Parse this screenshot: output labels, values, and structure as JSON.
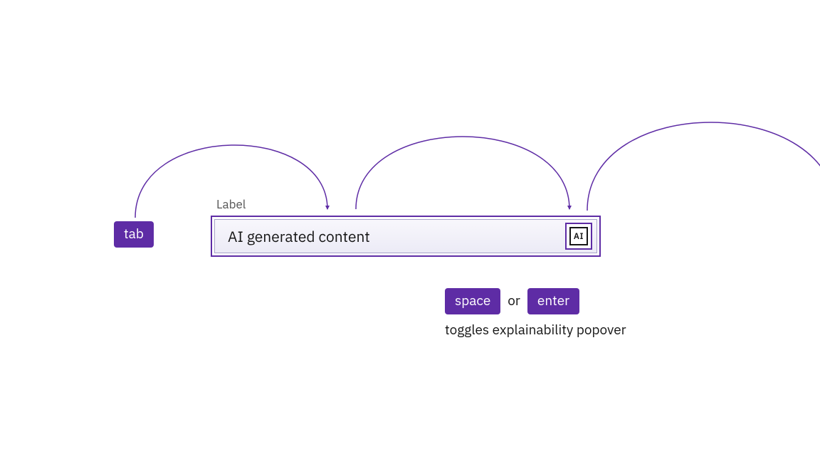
{
  "keys": {
    "tab": "tab",
    "space": "space",
    "or": "or",
    "enter": "enter"
  },
  "field": {
    "label": "Label",
    "content": "AI generated content",
    "ai_badge": "AI"
  },
  "description": "toggles explainability popover",
  "colors": {
    "purple": "#5e2ca5",
    "text": "#161616",
    "muted": "#555"
  }
}
